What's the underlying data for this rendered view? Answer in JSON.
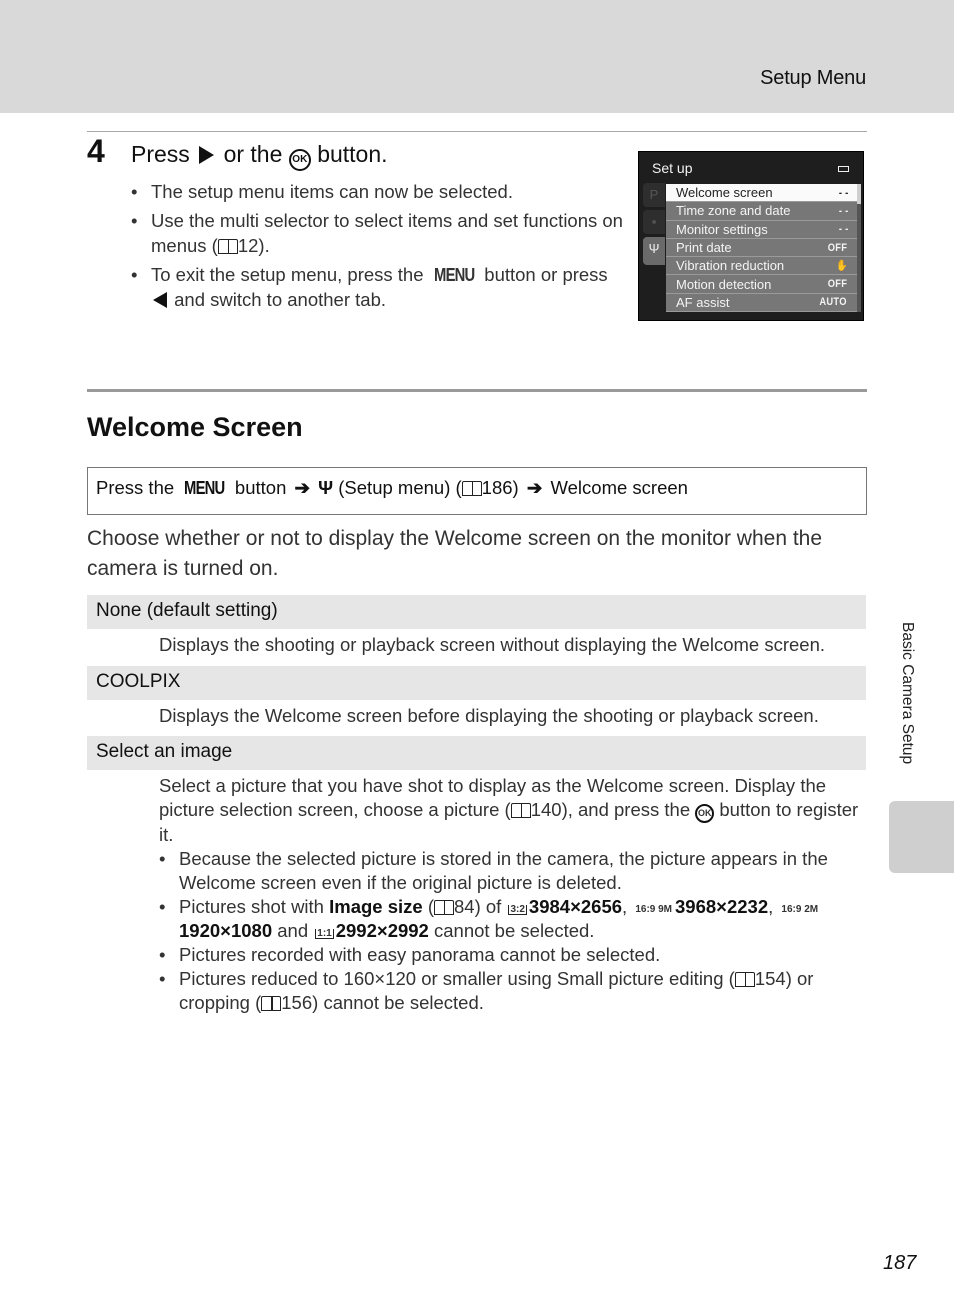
{
  "header": {
    "title": "Setup Menu"
  },
  "step": {
    "number": "4",
    "title_pre": "Press",
    "title_mid": "or the",
    "ok_label": "OK",
    "title_post": "button.",
    "bullets": [
      {
        "text": "The setup menu items can now be selected."
      },
      {
        "text_pre": "Use the multi selector to select items and set functions on menus (",
        "ref": "12",
        "text_post": ")."
      },
      {
        "text_pre": "To exit the setup menu, press the",
        "menu_label": "MENU",
        "text_mid": "button or press",
        "text_post": "and switch to another tab."
      }
    ]
  },
  "camera_screen": {
    "title": "Set up",
    "battery_icon": "battery-icon",
    "tabs": [
      {
        "icon": "P",
        "name": "shooting-tab"
      },
      {
        "icon": "🎥",
        "name": "movie-tab"
      },
      {
        "icon": "🔧",
        "name": "setup-tab",
        "active": true
      }
    ],
    "items": [
      {
        "label": "Welcome screen",
        "value": "- -",
        "selected": true
      },
      {
        "label": "Time zone and date",
        "value": "- -"
      },
      {
        "label": "Monitor settings",
        "value": "- -"
      },
      {
        "label": "Print date",
        "value": "OFF"
      },
      {
        "label": "Vibration reduction",
        "value": "✋"
      },
      {
        "label": "Motion detection",
        "value": "OFF"
      },
      {
        "label": "AF assist",
        "value": "AUTO"
      }
    ]
  },
  "section": {
    "title": "Welcome Screen",
    "nav_path": {
      "press": "Press the",
      "menu_label": "MENU",
      "button": "button",
      "setup_menu": "(Setup menu) (",
      "ref": "186",
      "close": ")",
      "target": "Welcome screen"
    },
    "intro": "Choose whether or not to display the Welcome screen on the monitor when the camera is turned on.",
    "options": [
      {
        "label": "None (default setting)",
        "desc": "Displays the shooting or playback screen without displaying the Welcome screen."
      },
      {
        "label": "COOLPIX",
        "desc": "Displays the Welcome screen before displaying the shooting or playback screen."
      },
      {
        "label": "Select an image",
        "desc_pre": "Select a picture that you have shot to display as the Welcome screen. Display the picture selection screen, choose a picture (",
        "desc_ref": "140",
        "desc_mid": "), and press the",
        "desc_ok": "OK",
        "desc_post": "button to register it.",
        "bullets": {
          "b1": "Because the selected picture is stored in the camera, the picture appears in the Welcome screen even if the original picture is deleted.",
          "b2_pre": "Pictures shot with",
          "b2_bold": "Image size",
          "b2_ref_open": " (",
          "b2_ref": "84",
          "b2_of": ") of",
          "sizes": [
            {
              "icon": "3:2",
              "value": "3984×2656"
            },
            {
              "icon": "16:9 9M",
              "value": "3968×2232"
            },
            {
              "icon": "16:9 2M",
              "value": "1920×1080"
            },
            {
              "icon": "1:1",
              "value": "2992×2992"
            }
          ],
          "b2_and": "and",
          "b2_post": "cannot be selected.",
          "b3": "Pictures recorded with easy panorama cannot be selected.",
          "b4_pre": "Pictures reduced to 160×120 or smaller using Small picture editing (",
          "b4_ref1": "154",
          "b4_mid": ") or cropping (",
          "b4_ref2": "156",
          "b4_post": ") cannot be selected."
        }
      }
    ]
  },
  "side_tab": {
    "label": "Basic Camera Setup"
  },
  "page_number": "187"
}
